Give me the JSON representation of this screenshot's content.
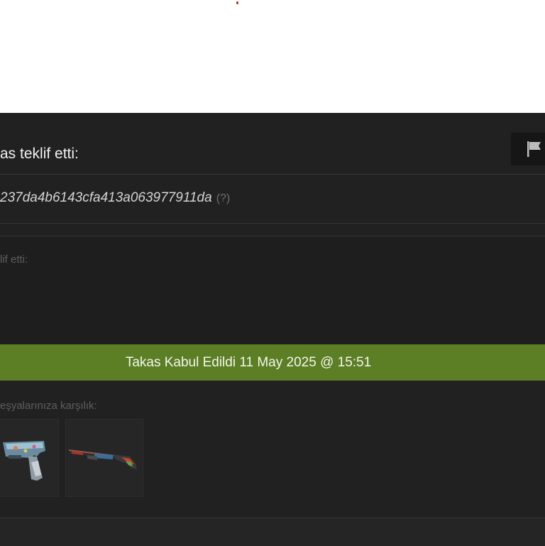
{
  "header": {
    "title": "as teklif etti:",
    "report_icon": "flag-icon"
  },
  "trade": {
    "id": "237da4b6143cfa413a063977911da",
    "help_text": "(?)"
  },
  "offer": {
    "label": "lif etti:"
  },
  "status": {
    "text": "Takas Kabul Edildi 11 May 2025 @ 15:51",
    "color": "#5c7e25"
  },
  "return_items": {
    "label": "eşyalarınıza karşılık:",
    "items": [
      {
        "icon": "pistol-skin-icon"
      },
      {
        "icon": "shotgun-skin-icon"
      }
    ]
  }
}
